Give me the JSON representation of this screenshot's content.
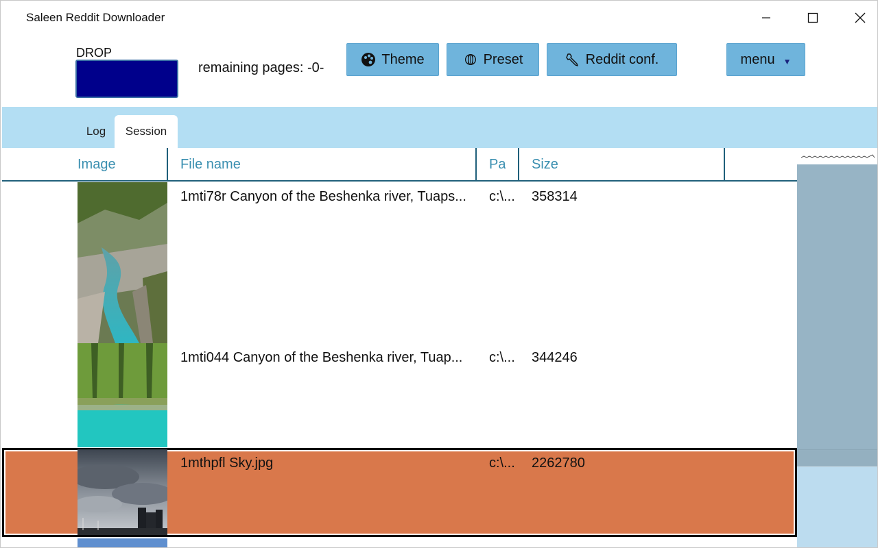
{
  "app": {
    "title": "Saleen Reddit Downloader"
  },
  "toolbar": {
    "drop_label": "DROP",
    "remaining_pages": "remaining pages: -0-",
    "theme_label": "Theme",
    "preset_label": "Preset",
    "reddit_label": "Reddit conf.",
    "menu_label": "menu"
  },
  "tabs": [
    {
      "label": "Log",
      "active": false
    },
    {
      "label": "Session",
      "active": true
    }
  ],
  "grid": {
    "columns": [
      "Image",
      "File name",
      "Pat",
      "Size"
    ],
    "rows": [
      {
        "file_name": "1mti78r Canyon of the Beshenka river, Tuaps...",
        "path": "c:\\...",
        "size": "358314",
        "selected": false
      },
      {
        "file_name": "1mti044 Canyon of the Beshenka river, Tuap...",
        "path": "c:\\...",
        "size": "344246",
        "selected": false
      },
      {
        "file_name": "1mthpfl Sky.jpg",
        "path": "c:\\...",
        "size": "2262780",
        "selected": true
      }
    ]
  },
  "colors": {
    "drop_box": "#00008b",
    "button": "#6fb4dc",
    "tabstrip": "#b3def3",
    "header_text": "#3a8fb0",
    "selected_row": "#d9784b",
    "scroll_area": "#97b4c5"
  },
  "icons": {
    "theme": "palette-icon",
    "preset": "globe-icon",
    "reddit": "wrench-icon",
    "menu": "caret-down-icon"
  }
}
